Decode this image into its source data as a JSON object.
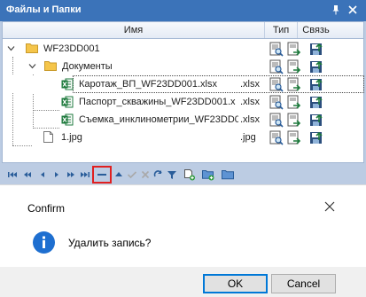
{
  "panel": {
    "title": "Файлы и Папки",
    "columns": {
      "name": "Имя",
      "type": "Тип",
      "link": "Связь"
    }
  },
  "rows": [
    {
      "name": "WF23DD001",
      "type": "",
      "kind": "folder"
    },
    {
      "name": "Документы",
      "type": "",
      "kind": "folder"
    },
    {
      "name": "Каротаж_ВП_WF23DD001.xlsx",
      "type": ".xlsx",
      "kind": "excel",
      "selected": true
    },
    {
      "name": "Паспорт_скважины_WF23DD001.x",
      "type": ".xlsx",
      "kind": "excel"
    },
    {
      "name": "Съемка_инклинометрии_WF23DD0",
      "type": ".xlsx",
      "kind": "excel"
    },
    {
      "name": "1.jpg",
      "type": ".jpg",
      "kind": "file"
    }
  ],
  "navigator": {
    "buttons": [
      "first",
      "prev-page",
      "prev",
      "next",
      "next-page",
      "last",
      "delete",
      "up",
      "post",
      "cancel",
      "refresh",
      "filter",
      "add-file",
      "add-folder",
      "open-folder"
    ]
  },
  "dialog": {
    "title": "Confirm",
    "message": "Удалить запись?",
    "ok_label": "OK",
    "cancel_label": "Cancel"
  },
  "colors": {
    "title_bar": "#3b73b9",
    "panel_bg": "#bccce3",
    "highlight": "#e02020",
    "ok_border": "#0078d7",
    "excel_green": "#1d7a3c",
    "folder_yellow": "#f5c54a"
  }
}
